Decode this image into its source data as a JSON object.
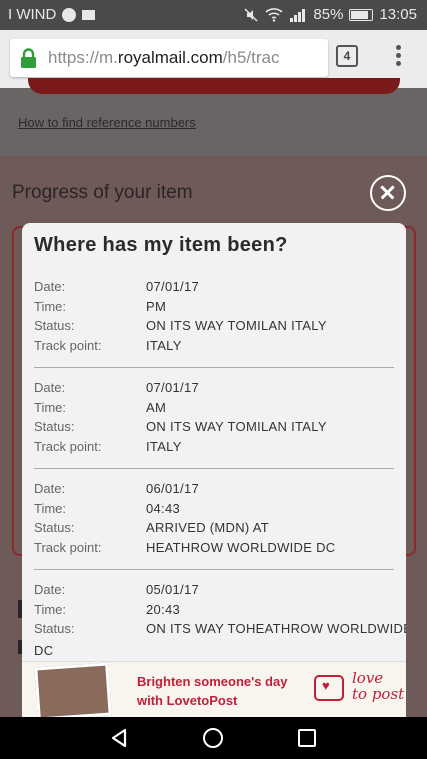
{
  "statusbar": {
    "carrier": "I WIND",
    "battery_percent": "85%",
    "battery_level": 0.85,
    "time": "13:05"
  },
  "browser": {
    "url_prefix": "https://m.",
    "url_host": "royalmail.com",
    "url_path": "/h5/trac",
    "tab_count": "4"
  },
  "page": {
    "link_text": "How to find reference numbers",
    "progress_heading": "Progress of your item"
  },
  "modal": {
    "title": "Where has my item been?",
    "labels": {
      "date": "Date:",
      "time": "Time:",
      "status": "Status:",
      "track_point": "Track point:"
    },
    "events": [
      {
        "date": "07/01/17",
        "time": "PM",
        "status": "ON ITS WAY TOMILAN ITALY",
        "track_point": "ITALY"
      },
      {
        "date": "07/01/17",
        "time": "AM",
        "status": "ON ITS WAY TOMILAN ITALY",
        "track_point": "ITALY"
      },
      {
        "date": "06/01/17",
        "time": "04:43",
        "status": "ARRIVED (MDN) AT",
        "track_point": "HEATHROW WORLDWIDE DC"
      },
      {
        "date": "05/01/17",
        "time": "20:43",
        "status_line1": "ON ITS WAY TOHEATHROW WORLDWIDE",
        "status_line2": "DC"
      }
    ]
  },
  "ad": {
    "line1": "Brighten someone's day",
    "line2": "with LovetoPost",
    "brand_line1": "love",
    "brand_line2": "to post"
  },
  "colors": {
    "accent_red": "#c0203a",
    "lock_green": "#2e9d3a"
  }
}
